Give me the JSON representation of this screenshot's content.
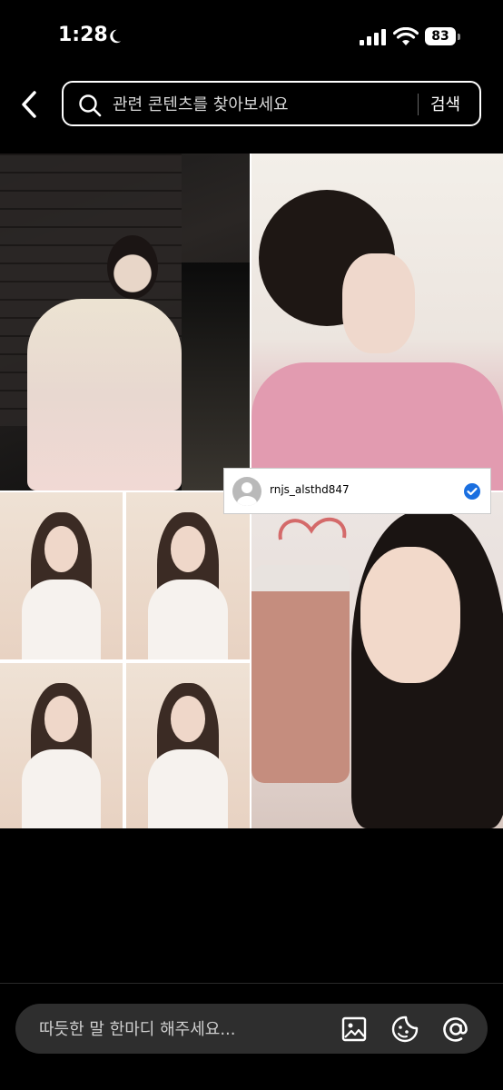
{
  "status_bar": {
    "time": "1:28",
    "battery": "83"
  },
  "search": {
    "placeholder": "관련 콘텐츠를 찾아보세요",
    "button_label": "검색"
  },
  "tag": {
    "username": "rnjs_alsthd847",
    "verified": true,
    "badge_color": "#1a6fe0"
  },
  "comment": {
    "placeholder": "따듯한 말 한마디 해주세요..."
  },
  "icons": {
    "back": "back-arrow-icon",
    "search": "search-icon",
    "image": "image-icon",
    "sticker": "sticker-icon",
    "mention": "at-mention-icon"
  }
}
